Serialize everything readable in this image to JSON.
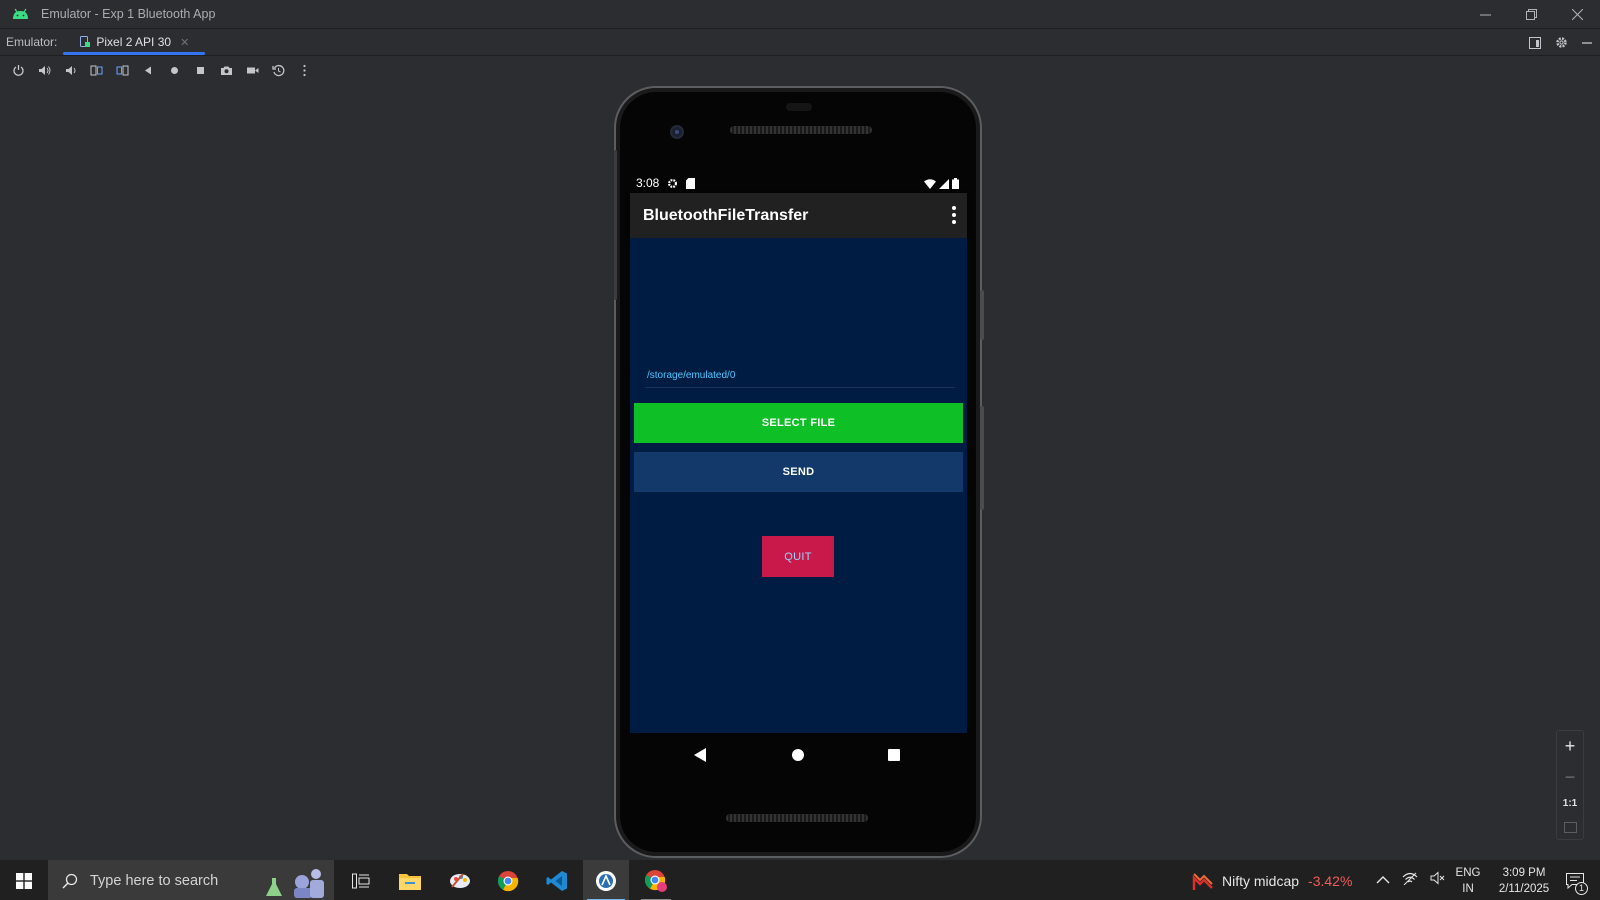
{
  "window": {
    "title": "Emulator - Exp 1 Bluetooth App"
  },
  "tabbar": {
    "label": "Emulator:",
    "tab": "Pixel 2 API 30"
  },
  "device": {
    "status_time": "3:08",
    "app_title": "BluetoothFileTransfer",
    "path": "/storage/emulated/0",
    "select_button": "SELECT FILE",
    "send_button": "SEND",
    "quit_button": "QUIT"
  },
  "zoom": {
    "plus": "+",
    "minus": "−",
    "ratio": "1:1"
  },
  "taskbar": {
    "search_placeholder": "Type here to search",
    "ticker_name": "Nifty midcap",
    "ticker_value": "-3.42%",
    "lang_line1": "ENG",
    "lang_line2": "IN",
    "time": "3:09 PM",
    "date": "2/11/2025",
    "notification_count": "1"
  },
  "colors": {
    "select_button": "#0fbf26",
    "send_button": "#12396a",
    "quit_button": "#c8194a",
    "app_background": "#001c43",
    "path_text": "#49c7ff"
  }
}
